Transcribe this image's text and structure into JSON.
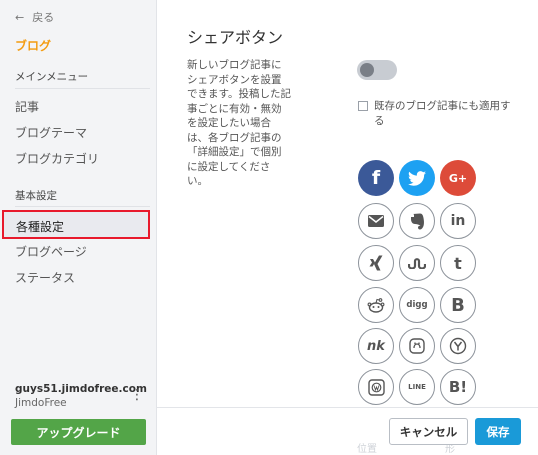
{
  "sidebar": {
    "back_label": "戻る",
    "brand_label": "ブログ",
    "main_menu_heading": "メインメニュー",
    "main_items": [
      "記事",
      "ブログテーマ",
      "ブログカテゴリ"
    ],
    "basic_heading": "基本設定",
    "active_item": "各種設定",
    "basic_items": [
      "ブログページ",
      "ステータス"
    ],
    "account_name": "guys51.jimdofree.com",
    "account_plan": "JimdoFree",
    "upgrade_label": "アップグレード"
  },
  "main": {
    "title": "シェアボタン",
    "description": "新しいブログ記事にシェアボタンを設置できます。投稿した記事ごとに有効・無効を設定したい場合は、各ブログ記事の「詳細設定」で個別に設定してください。",
    "toggle_on": false,
    "checkbox_label": "既存のブログ記事にも適用する",
    "checkbox_checked": false,
    "share_buttons": [
      {
        "icon": "facebook-icon",
        "glyph": "f",
        "style": "filled",
        "color": "#3b5998"
      },
      {
        "icon": "twitter-icon",
        "glyph": "",
        "style": "filled",
        "color": "#1da1f2"
      },
      {
        "icon": "google-plus-icon",
        "glyph": "G+",
        "style": "filled",
        "color": "#dd4b39"
      },
      {
        "icon": "email-icon",
        "glyph": "",
        "style": "outline"
      },
      {
        "icon": "evernote-icon",
        "glyph": "",
        "style": "outline"
      },
      {
        "icon": "linkedin-icon",
        "glyph": "in",
        "style": "outline"
      },
      {
        "icon": "xing-icon",
        "glyph": "",
        "style": "outline"
      },
      {
        "icon": "stumbleupon-icon",
        "glyph": "",
        "style": "outline"
      },
      {
        "icon": "tumblr-icon",
        "glyph": "t",
        "style": "outline"
      },
      {
        "icon": "reddit-icon",
        "glyph": "",
        "style": "outline"
      },
      {
        "icon": "digg-icon",
        "glyph": "digg",
        "style": "outline"
      },
      {
        "icon": "blogger-icon",
        "glyph": "B",
        "style": "outline"
      },
      {
        "icon": "newsvine-icon",
        "glyph": "nk",
        "style": "outline"
      },
      {
        "icon": "mixi-icon",
        "glyph": "",
        "style": "outline"
      },
      {
        "icon": "yahoo-icon",
        "glyph": "",
        "style": "outline"
      },
      {
        "icon": "wordpress-icon",
        "glyph": "",
        "style": "outline"
      },
      {
        "icon": "line-icon",
        "glyph": "LINE",
        "style": "outline"
      },
      {
        "icon": "hatena-icon",
        "glyph": "B!",
        "style": "outline"
      }
    ],
    "faded_labels": [
      "位置",
      "形"
    ]
  },
  "footer": {
    "cancel_label": "キャンセル",
    "save_label": "保存"
  }
}
